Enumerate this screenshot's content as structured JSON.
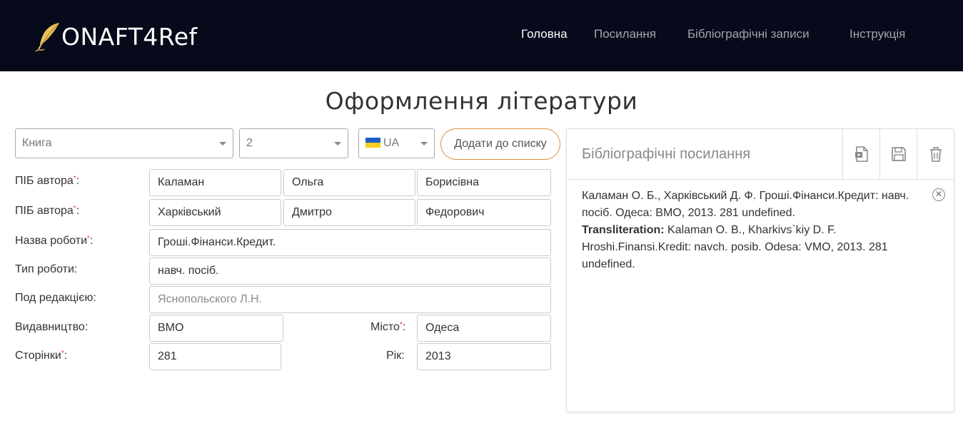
{
  "brand": {
    "name": "ONAFT4Ref",
    "icon": "quill-pen-icon"
  },
  "nav": [
    {
      "label": "Головна",
      "active": true
    },
    {
      "label": "Посилання",
      "active": false
    },
    {
      "label": "Бібліографічні записи",
      "active": false
    },
    {
      "label": "Інструкція",
      "active": false
    }
  ],
  "page_title": "Оформлення літератури",
  "controls": {
    "type_select": "Книга",
    "count_select": "2",
    "lang_select": "UA",
    "add_button": "Додати до списку"
  },
  "form": {
    "author_label": "ПІБ автора",
    "authors": [
      {
        "last": "Каламан",
        "first": "Ольга",
        "middle": "Борисівна"
      },
      {
        "last": "Харківський",
        "first": "Дмитро",
        "middle": "Федорович"
      }
    ],
    "title_label": "Назва роботи",
    "title_value": "Гроші.Фінанси.Кредит.",
    "worktype_label": "Тип роботи:",
    "worktype_value": "навч. посіб.",
    "editor_label": "Под редакцією:",
    "editor_placeholder": "Яснопольского Л.Н.",
    "publisher_label": "Видавництво:",
    "publisher_value": "ВМО",
    "city_label": "Місто",
    "city_value": "Одеса",
    "pages_label": "Сторінки",
    "pages_value": "281",
    "year_label": "Рік:",
    "year_value": "2013"
  },
  "panel": {
    "title": "Бібліографічні посилання",
    "entry_text": "Каламан О. Б., Харківський Д. Ф. Гроші.Фінанси.Кредит: навч. посіб. Одеса: ВМО, 2013. 281 undefined.",
    "translit_label": "Transliteration:",
    "translit_text": "Kalaman O. B., Kharkivs`kiy D. F. Hroshi.Finansi.Kredit: navch. posib. Odesa: VMO, 2013. 281 undefined."
  },
  "colors": {
    "navbar": "#070a1a",
    "accent": "#e08e3c",
    "required": "#e53935"
  }
}
